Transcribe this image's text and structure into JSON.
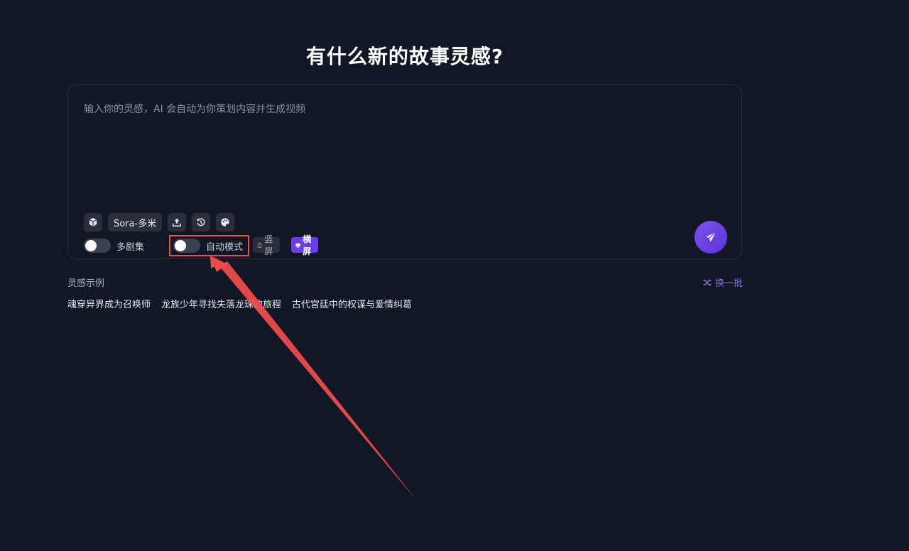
{
  "header": {
    "title": "有什么新的故事灵感?"
  },
  "prompt": {
    "placeholder": "输入你的灵感，AI 会自动为你策划内容并生成视频",
    "value": ""
  },
  "toolbar": {
    "model_label": "Sora-多米",
    "icons": [
      "cube-icon",
      "upload-icon",
      "history-icon",
      "palette-icon"
    ]
  },
  "options": {
    "multi_episode": {
      "label": "多剧集",
      "on": false
    },
    "auto_mode": {
      "label": "自动模式",
      "on": false
    },
    "orientation": {
      "portrait_label": "竖屏",
      "landscape_label": "横屏",
      "selected": "landscape"
    }
  },
  "examples": {
    "title": "灵感示例",
    "shuffle_label": "换一批",
    "items": [
      "魂穿异界成为召唤师",
      "龙族少年寻找失落龙珠的旅程",
      "古代宫廷中的权谋与爱情纠葛"
    ]
  },
  "colors": {
    "background": "#121725",
    "accent": "#6a3ee8",
    "annotation": "#ef4b4b"
  }
}
